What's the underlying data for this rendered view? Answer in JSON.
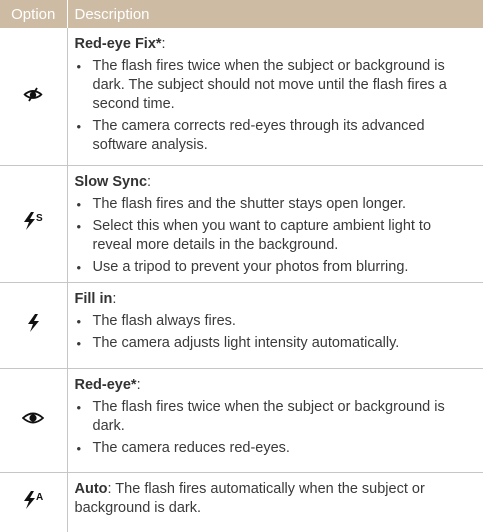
{
  "header": {
    "option": "Option",
    "description": "Description"
  },
  "rows": [
    {
      "icon": "red-eye-fix-icon",
      "title": "Red-eye Fix*",
      "suffix": ":",
      "bullets": [
        "The flash fires twice when the subject or background is dark. The subject should not move until the flash fires a second time.",
        "The camera corrects red-eyes through its advanced software analysis."
      ]
    },
    {
      "icon": "slow-sync-flash-icon",
      "title": "Slow Sync",
      "suffix": ":",
      "bullets": [
        "The flash fires and the shutter stays open longer.",
        "Select this when you want to capture ambient light to reveal more details in the background.",
        "Use a tripod to prevent your photos from blurring."
      ]
    },
    {
      "icon": "fill-in-flash-icon",
      "title": "Fill in",
      "suffix": ":",
      "bullets": [
        "The flash always fires.",
        "The camera adjusts light intensity automatically."
      ]
    },
    {
      "icon": "red-eye-icon",
      "title": "Red-eye*",
      "suffix": ":",
      "bullets": [
        "The flash fires twice when the subject or background is dark.",
        "The camera reduces red-eyes."
      ]
    },
    {
      "icon": "auto-flash-icon",
      "title": "Auto",
      "suffix": ": The flash fires automatically when the subject or background is dark.",
      "bullets": []
    }
  ],
  "glyphs": {
    "bullet": "•",
    "slow_sync_mark": "S",
    "auto_mark": "A"
  }
}
